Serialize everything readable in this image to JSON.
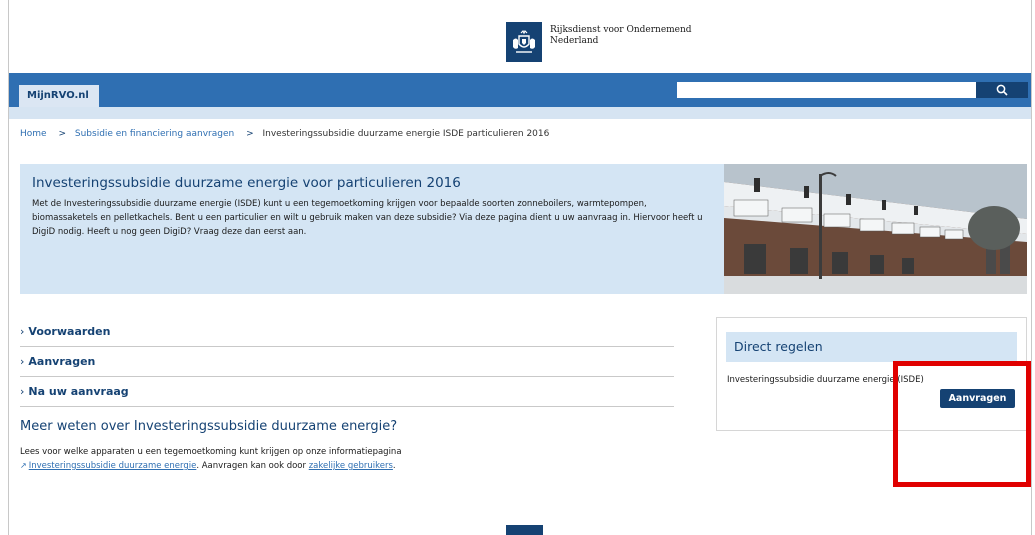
{
  "header": {
    "org_line1": "Rijksdienst voor Ondernemend",
    "org_line2": "Nederland"
  },
  "nav": {
    "tab_label": "MijnRVO.nl",
    "search_placeholder": "",
    "search_icon": "search-icon"
  },
  "breadcrumb": {
    "home": "Home",
    "item1": "Subsidie en financiering aanvragen",
    "current": "Investeringssubsidie duurzame energie ISDE particulieren 2016"
  },
  "hero": {
    "title": "Investeringssubsidie duurzame energie voor particulieren 2016",
    "text": "Met de Investeringssubsidie duurzame energie (ISDE) kunt u een tegemoetkoming krijgen voor bepaalde soorten zonneboilers, warmtepompen, biomassaketels en pelletkachels. Bent u een particulier en wilt u gebruik maken van deze subsidie? Via deze pagina dient u uw aanvraag in. Hiervoor heeft u DigiD nodig. Heeft u nog geen DigiD? Vraag deze dan eerst aan."
  },
  "accordion": {
    "item1": "Voorwaarden",
    "item2": "Aanvragen",
    "item3": "Na uw aanvraag"
  },
  "more": {
    "title": "Meer weten over Investeringssubsidie duurzame energie?",
    "text_part1": "Lees voor welke apparaten u een tegemoetkoming kunt krijgen op onze informatiepagina",
    "link1": "Investeringssubsidie duurzame energie",
    "text_part2": ". Aanvragen kan ook door ",
    "link2": "zakelijke gebruikers",
    "text_part3": "."
  },
  "direct": {
    "title": "Direct regelen",
    "label": "Investeringssubsidie duurzame energie (ISDE)",
    "button": "Aanvragen"
  },
  "colors": {
    "brand_dark": "#154273",
    "brand_blue": "#2f6fb2",
    "light_blue": "#d4e5f4",
    "highlight_red": "#e00000"
  }
}
